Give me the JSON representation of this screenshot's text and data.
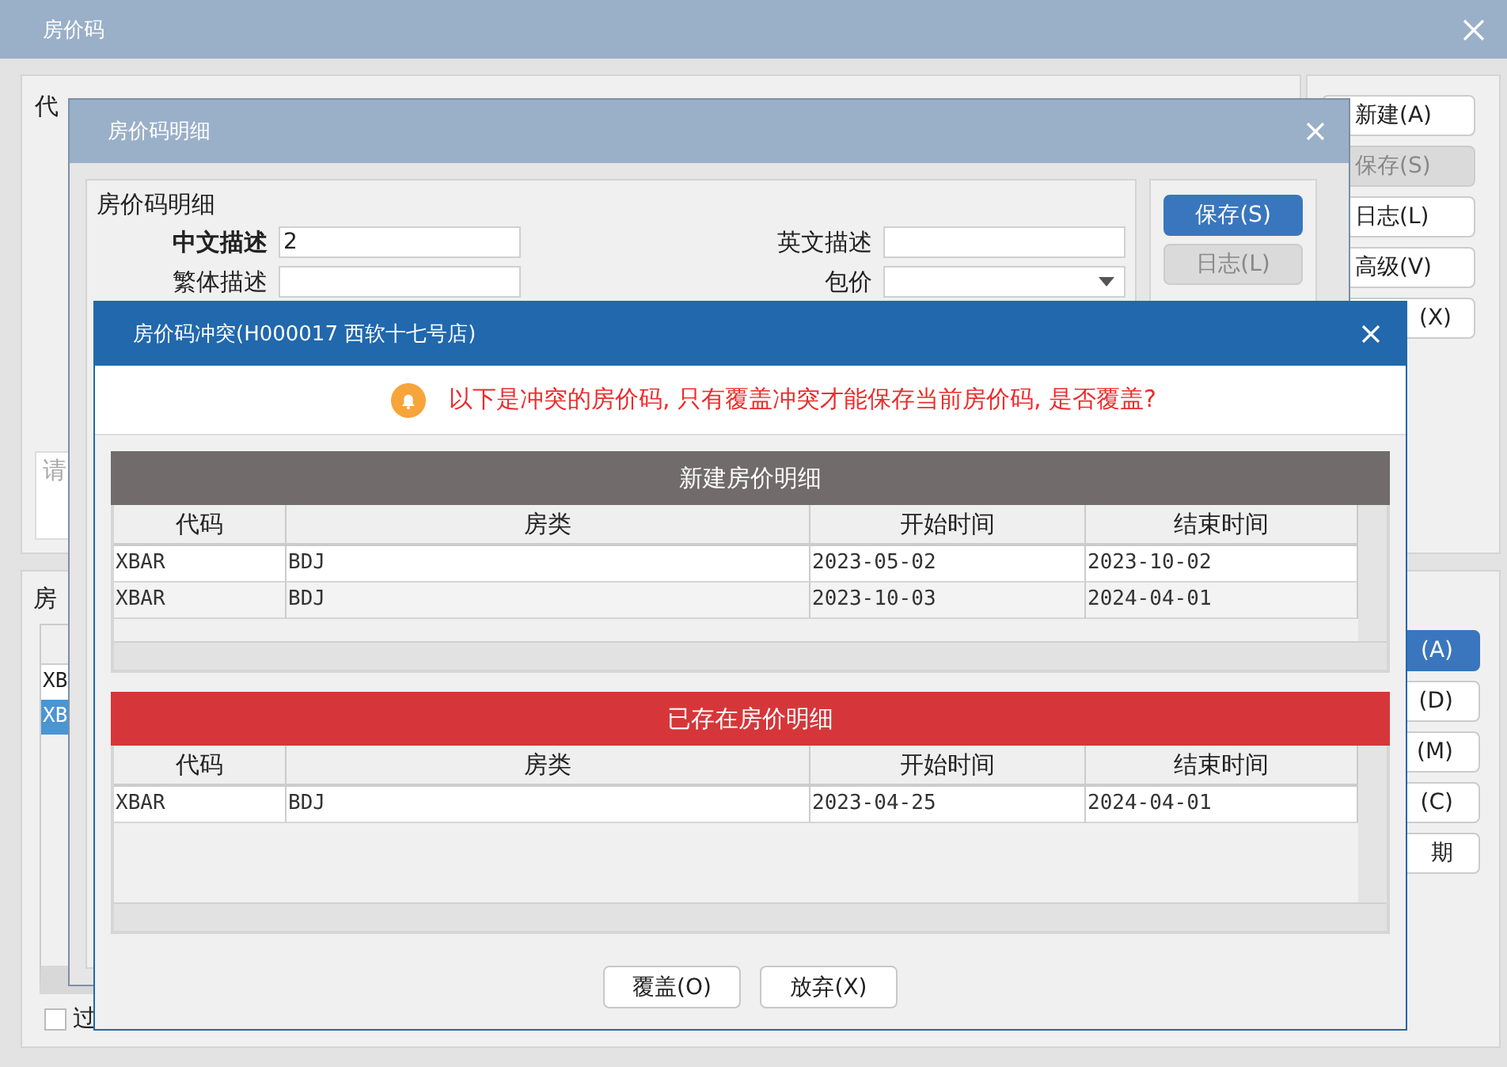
{
  "background_window": {
    "title": "房价码",
    "section_label": "代",
    "note_placeholder": "请",
    "list_label": "房",
    "list_rows": [
      {
        "code": "XB",
        "selected": false
      },
      {
        "code": "XB",
        "selected": true
      }
    ],
    "filter_checkbox": {
      "label": "过",
      "checked": false
    },
    "side_buttons": [
      {
        "label": "新建(A)",
        "disabled": false
      },
      {
        "label": "保存(S)",
        "disabled": true
      },
      {
        "label": "日志(L)",
        "disabled": false
      },
      {
        "label": "高级(V)",
        "disabled": false
      },
      {
        "label": "(X)",
        "disabled": false
      }
    ],
    "lower_buttons": [
      {
        "label": "(A)",
        "primary": true
      },
      {
        "label": "(D)",
        "primary": false
      },
      {
        "label": "(M)",
        "primary": false
      },
      {
        "label": "(C)",
        "primary": false
      },
      {
        "label": "期",
        "primary": false
      }
    ]
  },
  "detail_window": {
    "title": "房价码明细",
    "group_title": "房价码明细",
    "fields_left": [
      {
        "label": "中文描述",
        "value": "2",
        "emphasized": true,
        "kind": "text"
      },
      {
        "label": "繁体描述",
        "emphasized": false,
        "kind": "text"
      }
    ],
    "fields_right": [
      {
        "label": "英文描述",
        "emphasized": false,
        "kind": "text"
      },
      {
        "label": "包价",
        "emphasized": false,
        "kind": "dropdown"
      }
    ],
    "buttons": [
      {
        "label": "保存(S)",
        "primary": true,
        "disabled": false
      },
      {
        "label": "日志(L)",
        "primary": false,
        "disabled": true
      }
    ]
  },
  "conflict_dialog": {
    "title": "房价码冲突(H000017 西软十七号店)",
    "message": "以下是冲突的房价码, 只有覆盖冲突才能保存当前房价码, 是否覆盖?",
    "sections": [
      {
        "title": "新建房价明细",
        "color": "#716b6b",
        "columns": [
          "代码",
          "房类",
          "开始时间",
          "结束时间"
        ],
        "rows": [
          [
            "XBAR",
            "BDJ",
            "2023-05-02",
            "2023-10-02"
          ],
          [
            "XBAR",
            "BDJ",
            "2023-10-03",
            "2024-04-01"
          ]
        ]
      },
      {
        "title": "已存在房价明细",
        "color": "#d63639",
        "columns": [
          "代码",
          "房类",
          "开始时间",
          "结束时间"
        ],
        "rows": [
          [
            "XBAR",
            "BDJ",
            "2023-04-25",
            "2024-04-01"
          ]
        ]
      }
    ],
    "buttons": [
      "覆盖(O)",
      "放弃(X)"
    ]
  }
}
